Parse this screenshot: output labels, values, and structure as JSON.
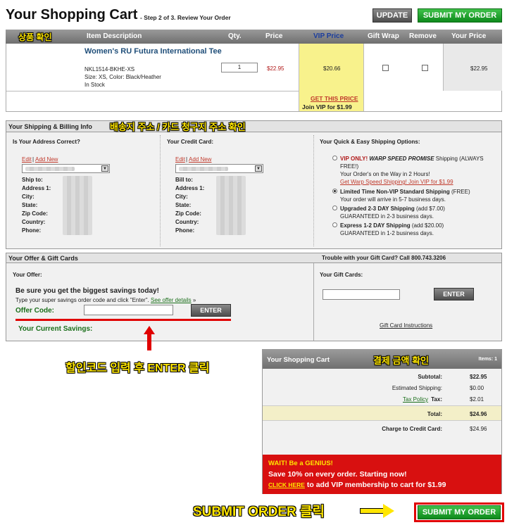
{
  "header": {
    "title": "Your Shopping Cart",
    "step": "- Step 2 of 3. Review Your Order",
    "update_label": "UPDATE",
    "submit_label": "SUBMIT MY ORDER"
  },
  "cart_table": {
    "col_korean": "상품 확인",
    "col_item": "Item Description",
    "col_qty": "Qty.",
    "col_price": "Price",
    "col_vip": "VIP Price",
    "col_gift": "Gift Wrap",
    "col_remove": "Remove",
    "col_your": "Your Price",
    "item_name": "Women's RU Futura International Tee",
    "sku": "NKL1514-BKHE-XS",
    "options": "Size: XS, Color: Black/Heather",
    "stock": "In Stock",
    "qty": "1",
    "price": "$22.95",
    "vip_price": "$20.66",
    "get_price": "GET THIS PRICE",
    "join_vip": "Join VIP for $1.99",
    "your_price": "$22.95"
  },
  "shipping": {
    "head": "Your Shipping & Billing Info",
    "annotation": "배송지 주소 / 카드 청구지 주소 확인",
    "address_title": "Is Your Address Correct?",
    "edit": "Edit",
    "add_new": "Add New",
    "address_fields": [
      "Ship to:",
      "Address 1:",
      "City:",
      "State:",
      "Zip Code:",
      "Country:",
      "Phone:"
    ],
    "card_title": "Your Credit Card:",
    "card_fields": [
      "Bill to:",
      "Address 1:",
      "City:",
      "State:",
      "Zip Code:",
      "Country:",
      "Phone:"
    ],
    "options_title": "Your Quick & Easy Shipping Options:",
    "opt1_a": "VIP ONLY! ",
    "opt1_b": "WARP SPEED PROMISE",
    "opt1_c": " Shipping (ALWAYS FREE!)",
    "opt1_d": "Your Order's on the Way in 2 Hours!",
    "opt1_link": "Get Warp Speed Shipping! Join VIP for $1.99",
    "opt2_a": "Limited Time Non-VIP Standard Shipping",
    "opt2_b": " (FREE)",
    "opt2_c": "Your order will arrive in 5-7 business days.",
    "opt3_a": "Upgraded 2-3 DAY Shipping",
    "opt3_b": " (add $7.00)",
    "opt3_c": "GUARANTEED in 2-3 business days.",
    "opt4_a": "Express 1-2 DAY Shipping",
    "opt4_b": " (add $20.00)",
    "opt4_c": "GUARANTEED in 1-2 business days."
  },
  "offer": {
    "head": "Your Offer & Gift Cards",
    "trouble": "Trouble with your Gift Card? Call 800.743.3206",
    "your_offer": "Your Offer:",
    "savings_title": "Be sure you get the biggest savings today!",
    "instr": "Type your super savings order code and click \"Enter\". ",
    "see_offer": "See offer details",
    "arrow": " »",
    "code_label": "Offer Code:",
    "enter": "ENTER",
    "current_savings": "Your Current Savings:",
    "gift_title": "Your Gift Cards:",
    "gift_enter": "ENTER",
    "gift_instr": "Gift Card Instructions",
    "annotation": "할인코드 입력 후 ENTER 클릭"
  },
  "summary": {
    "head": "Your Shopping Cart",
    "items": "Items: 1",
    "annotation": "결제 금액 확인",
    "subtotal_label": "Subtotal:",
    "subtotal": "$22.95",
    "ship_label": "Estimated Shipping:",
    "ship": "$0.00",
    "tax_policy": "Tax Policy",
    "tax_label": "Tax:",
    "tax": "$2.01",
    "total_label": "Total:",
    "total": "$24.96",
    "charge_label": "Charge to Credit Card:",
    "charge": "$24.96"
  },
  "promo": {
    "title": "WAIT! Be a GENIUS!",
    "line1": "Save 10% on every order. Starting now!",
    "click": "CLICK HERE",
    "line2": " to add VIP membership to cart for $1.99"
  },
  "bottom": {
    "annotation": "SUBMIT ORDER 클릭",
    "submit_label": "SUBMIT MY ORDER"
  }
}
